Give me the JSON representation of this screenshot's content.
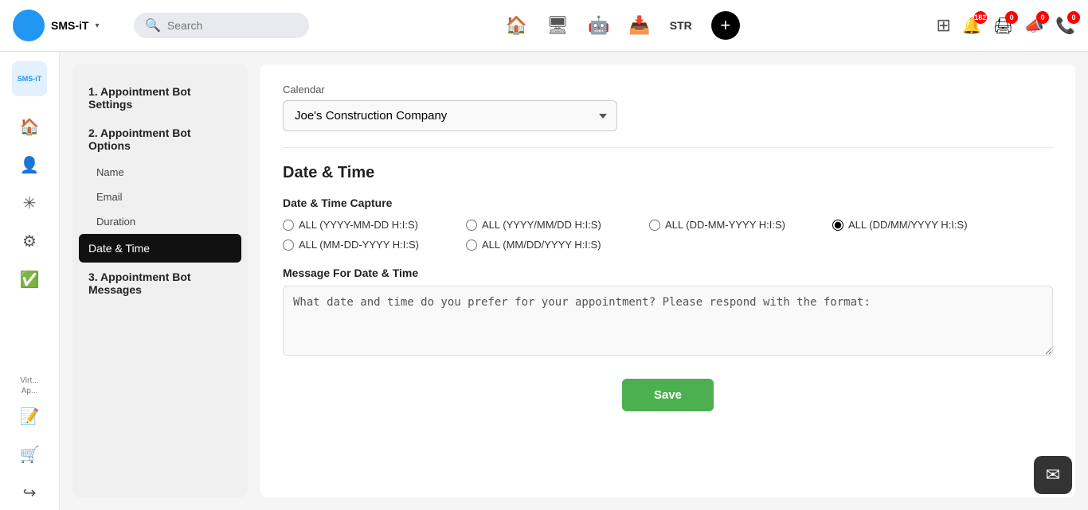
{
  "topnav": {
    "brand": "SMS-iT",
    "search_placeholder": "Search",
    "str_label": "STR",
    "plus_label": "+",
    "badges": {
      "notifications": "182",
      "cart": "0",
      "megaphone": "0",
      "phone": "0"
    }
  },
  "sidebar": {
    "logo": "SMS-iT",
    "items": [
      {
        "icon": "🏠",
        "label": "Home"
      },
      {
        "icon": "👤",
        "label": "User"
      },
      {
        "icon": "✳️",
        "label": "Network"
      },
      {
        "icon": "🔧",
        "label": "Tools"
      },
      {
        "icon": "📋",
        "label": "Tasks"
      }
    ],
    "bottom_items": [
      {
        "label": "Virt..."
      },
      {
        "label": "Ap..."
      },
      {
        "icon": "📝",
        "label": ""
      },
      {
        "icon": "🛒",
        "label": ""
      },
      {
        "icon": "↪",
        "label": ""
      }
    ]
  },
  "left_panel": {
    "items": [
      {
        "id": "appt-settings",
        "label": "1. Appointment Bot Settings",
        "type": "heading"
      },
      {
        "id": "appt-options",
        "label": "2. Appointment Bot Options",
        "type": "heading"
      },
      {
        "id": "name",
        "label": "Name",
        "type": "sub"
      },
      {
        "id": "email",
        "label": "Email",
        "type": "sub"
      },
      {
        "id": "duration",
        "label": "Duration",
        "type": "sub"
      },
      {
        "id": "date-time",
        "label": "Date & Time",
        "type": "active"
      },
      {
        "id": "appt-messages",
        "label": "3. Appointment Bot Messages",
        "type": "heading"
      }
    ]
  },
  "content": {
    "calendar_label": "Calendar",
    "calendar_value": "Joe's Construction Company",
    "calendar_options": [
      "Joe's Construction Company"
    ],
    "date_time_section": "Date & Time",
    "capture_label": "Date & Time Capture",
    "radio_options": [
      {
        "id": "opt1",
        "label": "ALL (YYYY-MM-DD H:I:S)",
        "checked": false
      },
      {
        "id": "opt2",
        "label": "ALL (YYYY/MM/DD H:I:S)",
        "checked": false
      },
      {
        "id": "opt3",
        "label": "ALL (DD-MM-YYYY H:I:S)",
        "checked": false
      },
      {
        "id": "opt4",
        "label": "ALL (DD/MM/YYYY H:I:S)",
        "checked": true
      },
      {
        "id": "opt5",
        "label": "ALL (MM-DD-YYYY H:I:S)",
        "checked": false
      },
      {
        "id": "opt6",
        "label": "ALL (MM/DD/YYYY H:I:S)",
        "checked": false
      }
    ],
    "message_label": "Message For Date & Time",
    "message_value": "What date and time do you prefer for your appointment? Please respond with the format:",
    "save_label": "Save"
  },
  "chat_icon": "✉"
}
